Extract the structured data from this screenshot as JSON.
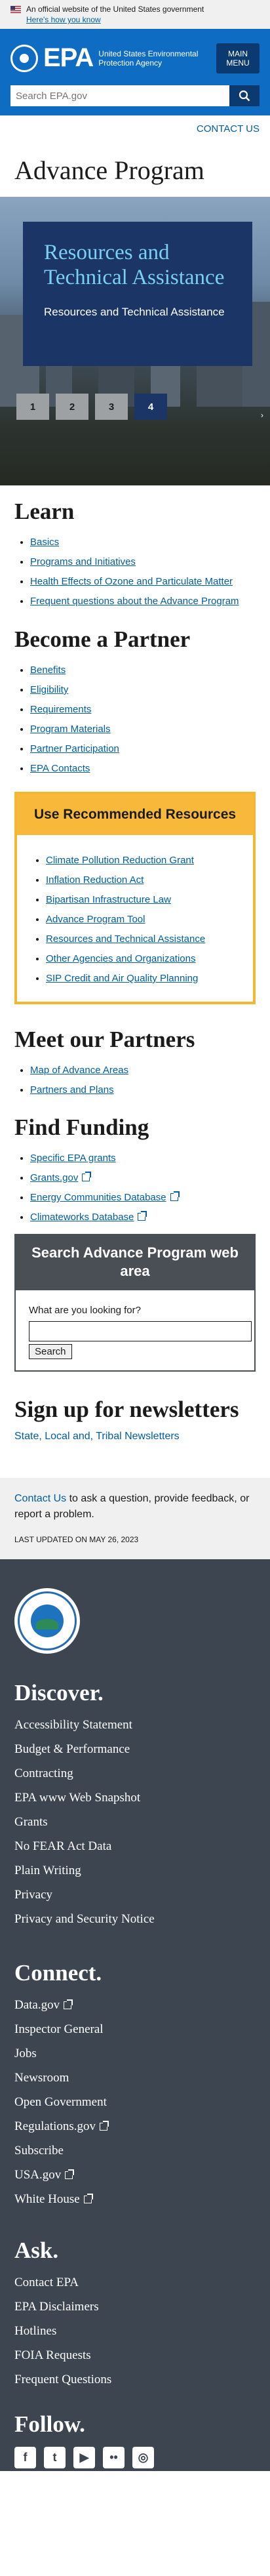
{
  "gov_banner": {
    "text": "An official website of the United States government",
    "link": "Here's how you know"
  },
  "header": {
    "logo": "EPA",
    "agency": "United States Environmental Protection Agency",
    "menu_label": "MAIN MENU",
    "search_placeholder": "Search EPA.gov"
  },
  "contact_us": "CONTACT US",
  "page_title": "Advance Program",
  "hero": {
    "heading": "Resources and Technical Assistance",
    "link": "Resources and Technical Assistance",
    "pages": [
      "1",
      "2",
      "3",
      "4"
    ],
    "active_page": "4",
    "corner": "›"
  },
  "learn": {
    "title": "Learn",
    "items": [
      "Basics",
      "Programs and Initiatives",
      "Health Effects of Ozone and Particulate Matter",
      "Frequent questions about the Advance Program"
    ]
  },
  "partner": {
    "title": "Become a Partner",
    "items": [
      "Benefits",
      "Eligibility",
      "Requirements",
      "Program Materials",
      "Partner Participation",
      "EPA Contacts"
    ]
  },
  "resources": {
    "title": "Use Recommended Resources",
    "items": [
      "Climate Pollution Reduction Grant",
      "Inflation Reduction Act",
      "Bipartisan Infrastructure Law",
      "Advance Program Tool",
      "Resources and Technical Assistance",
      "Other Agencies and Organizations",
      "SIP Credit and Air Quality Planning"
    ]
  },
  "meet": {
    "title": "Meet our Partners",
    "items": [
      "Map of Advance Areas",
      "Partners and Plans"
    ]
  },
  "funding": {
    "title": "Find Funding",
    "items": [
      "Specific EPA grants",
      "Grants.gov",
      "Energy Communities Database",
      "Climateworks Database"
    ]
  },
  "program_search": {
    "title": "Search Advance Program web area",
    "label": "What are you looking for?",
    "button": "Search"
  },
  "newsletter": {
    "title": "Sign up for newsletters",
    "link": "State, Local and, Tribal Newsletters"
  },
  "feedback": {
    "link": "Contact Us",
    "text": " to ask a question, provide feedback, or report a problem.",
    "updated": "LAST UPDATED ON MAY 26, 2023"
  },
  "footer": {
    "discover_title": "Discover.",
    "discover": [
      "Accessibility Statement",
      "Budget & Performance",
      "Contracting",
      "EPA www Web Snapshot",
      "Grants",
      "No FEAR Act Data",
      "Plain Writing",
      "Privacy",
      "Privacy and Security Notice"
    ],
    "connect_title": "Connect.",
    "connect": [
      "Data.gov",
      "Inspector General",
      "Jobs",
      "Newsroom",
      "Open Government",
      "Regulations.gov",
      "Subscribe",
      "USA.gov",
      "White House"
    ],
    "ask_title": "Ask.",
    "ask": [
      "Contact EPA",
      "EPA Disclaimers",
      "Hotlines",
      "FOIA Requests",
      "Frequent Questions"
    ],
    "follow_title": "Follow.",
    "social": [
      {
        "icon": "facebook-icon",
        "glyph": "f"
      },
      {
        "icon": "twitter-icon",
        "glyph": "t"
      },
      {
        "icon": "youtube-icon",
        "glyph": "▶"
      },
      {
        "icon": "flickr-icon",
        "glyph": "••"
      },
      {
        "icon": "instagram-icon",
        "glyph": "◎"
      }
    ]
  }
}
